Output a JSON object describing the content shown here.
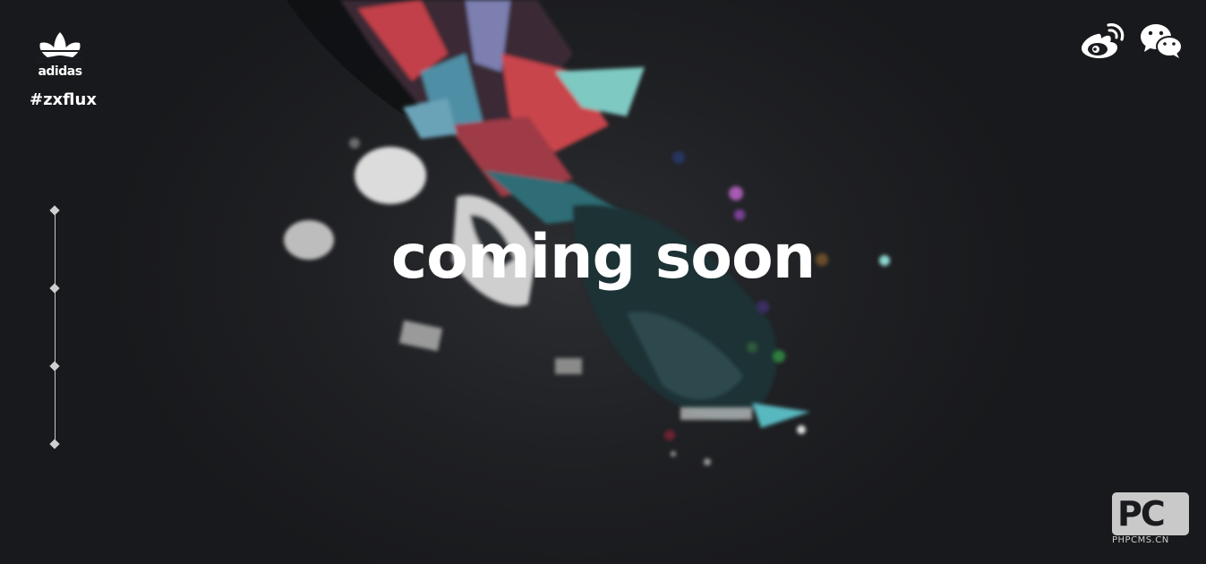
{
  "brand": {
    "wordmark": "adidas",
    "hashtag": "#zxflux"
  },
  "headline": "coming soon",
  "timeline": {
    "dots": [
      "dot-1",
      "dot-2",
      "dot-3",
      "dot-4"
    ]
  },
  "social": {
    "weibo_icon": "weibo-icon",
    "wechat_icon": "wechat-icon"
  },
  "watermark": {
    "logo_text": "PC",
    "site": "PHPCMS.CN"
  },
  "colors": {
    "background": "#1b1c1f",
    "text": "#ffffff",
    "accent_red": "#d9483b",
    "accent_teal": "#79c9c1"
  }
}
